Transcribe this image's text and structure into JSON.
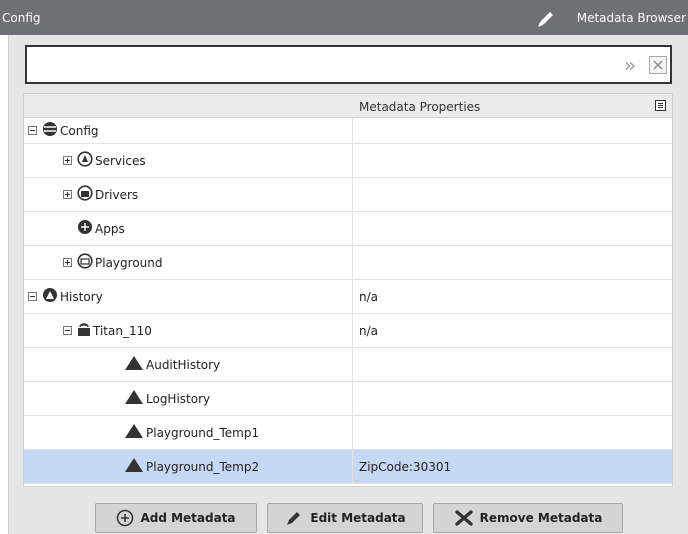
{
  "window": {
    "title": "Config",
    "view_name": "Metadata Browser"
  },
  "search": {
    "value": "",
    "placeholder": ""
  },
  "table": {
    "columns": [
      "",
      "Metadata Properties"
    ],
    "rows": [
      {
        "label": "Config",
        "value": "",
        "icon": "database-icon",
        "expander": "minus",
        "indent": 0,
        "selected": false
      },
      {
        "label": "Services",
        "value": "",
        "icon": "services-icon",
        "expander": "plus",
        "indent": 1,
        "selected": false
      },
      {
        "label": "Drivers",
        "value": "",
        "icon": "drivers-icon",
        "expander": "plus",
        "indent": 1,
        "selected": false
      },
      {
        "label": "Apps",
        "value": "",
        "icon": "apps-icon",
        "expander": "none",
        "indent": 1,
        "selected": false
      },
      {
        "label": "Playground",
        "value": "",
        "icon": "folder-icon",
        "expander": "plus",
        "indent": 1,
        "selected": false
      },
      {
        "label": "History",
        "value": "n/a",
        "icon": "history-icon",
        "expander": "minus",
        "indent": 0,
        "selected": false
      },
      {
        "label": "Titan_110",
        "value": "n/a",
        "icon": "device-icon",
        "expander": "minus",
        "indent": 1,
        "selected": false
      },
      {
        "label": "AuditHistory",
        "value": "",
        "icon": "history-item-icon",
        "expander": "none",
        "indent": 2,
        "selected": false
      },
      {
        "label": "LogHistory",
        "value": "",
        "icon": "history-item-icon",
        "expander": "none",
        "indent": 2,
        "selected": false
      },
      {
        "label": "Playground_Temp1",
        "value": "",
        "icon": "history-item-icon",
        "expander": "none",
        "indent": 2,
        "selected": false
      },
      {
        "label": "Playground_Temp2",
        "value": "ZipCode:30301",
        "icon": "history-item-icon",
        "expander": "none",
        "indent": 2,
        "selected": true
      }
    ]
  },
  "buttons": {
    "add": "Add Metadata",
    "edit": "Edit Metadata",
    "remove": "Remove Metadata"
  },
  "colors": {
    "titlebar": "#6f6f76",
    "selected_row": "#c5d9f4",
    "icon": "#333333"
  }
}
